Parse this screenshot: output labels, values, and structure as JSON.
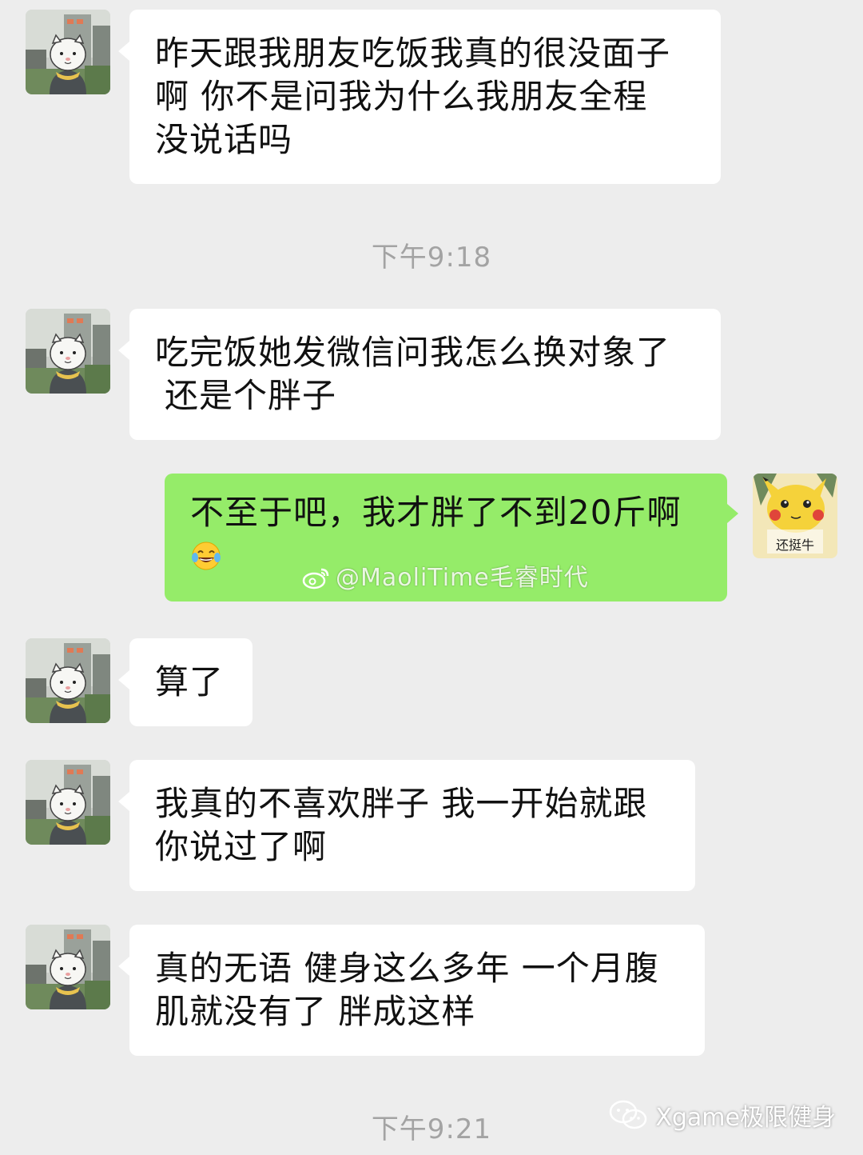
{
  "messages": [
    {
      "side": "left",
      "text_lines": [
        "昨天跟我朋友吃饭我真的很没面子",
        "啊 你不是问我为什么我朋友全程",
        "没说话吗"
      ]
    },
    {
      "side": "left",
      "text_lines": [
        "吃完饭她发微信问我怎么换对象了",
        "还是个胖子"
      ]
    },
    {
      "side": "right",
      "text_lines": [
        "不至于吧，我才胖了不到20斤啊"
      ],
      "emoji": "face-with-tears-of-joy",
      "watermark": "@MaoliTime毛睿时代"
    },
    {
      "side": "left",
      "text_lines": [
        "算了"
      ]
    },
    {
      "side": "left",
      "text_lines": [
        "我真的不喜欢胖子 我一开始就跟",
        "你说过了啊"
      ]
    },
    {
      "side": "left",
      "text_lines": [
        "真的无语 健身这么多年 一个月腹",
        "肌就没有了 胖成这样"
      ]
    }
  ],
  "timestamps": [
    "下午9:18",
    "下午9:21"
  ],
  "self_avatar": {
    "caption": "还挺牛",
    "icon": "pikachu-avatar"
  },
  "other_avatar": {
    "icon": "cartoon-cat-avatar"
  },
  "footer_watermark": "Xgame极限健身",
  "colors": {
    "background": "#ededed",
    "incoming": "#ffffff",
    "outgoing": "#95ec69",
    "timestamp": "#a3a3a3"
  }
}
